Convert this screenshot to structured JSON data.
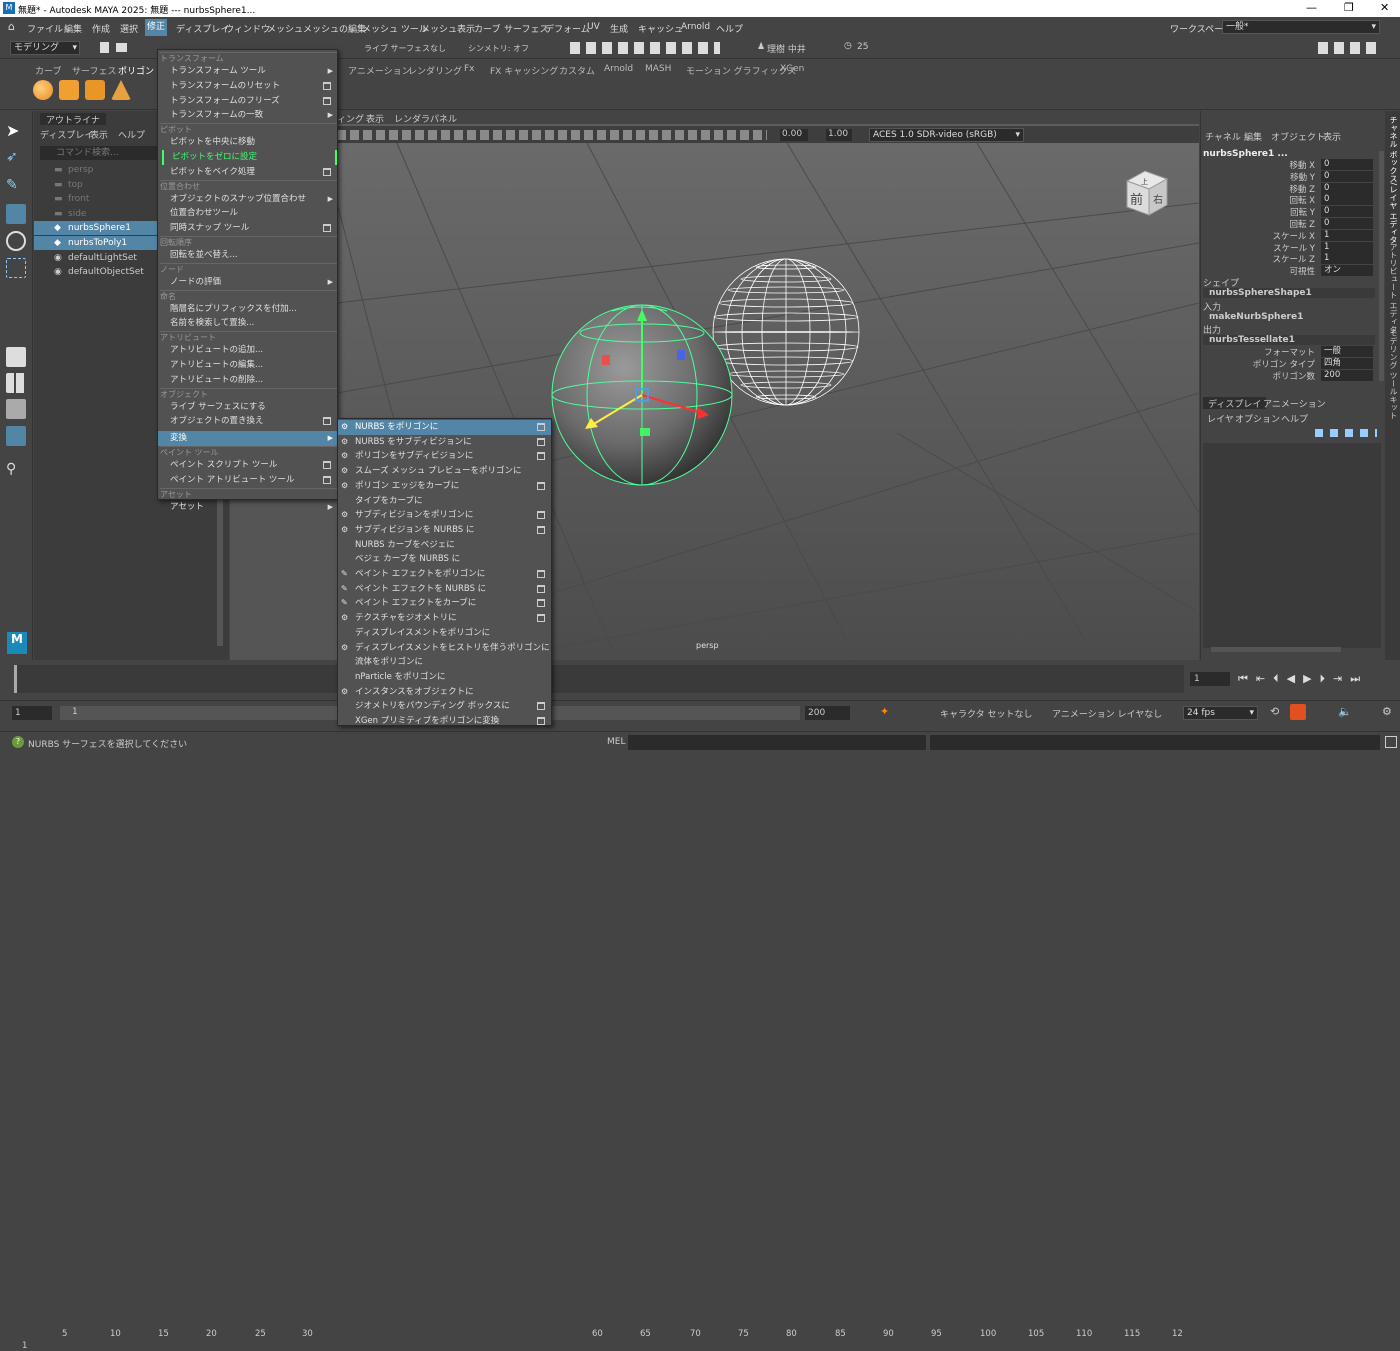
{
  "titlebar": {
    "title": "無題* - Autodesk MAYA 2025: 無題 --- nurbsSphere1...",
    "minimize": "—",
    "maximize": "❐",
    "close": "✕"
  },
  "menubar": {
    "items": [
      "ファイル",
      "編集",
      "作成",
      "選択",
      "修正",
      "ディスプレイ",
      "ウィンドウ",
      "メッシュ",
      "メッシュの編集",
      "メッシュ ツール",
      "メッシュ表示",
      "カーブ",
      "サーフェス",
      "デフォーム",
      "UV",
      "生成",
      "キャッシュ",
      "Arnold",
      "ヘルプ"
    ],
    "workspace_label": "ワークスペース:",
    "workspace_value": "一般*"
  },
  "statusline": {
    "mode": "モデリング",
    "live": "ライブ サーフェスなし",
    "symmetry": "シンメトリ: オフ",
    "user": "理樹 中井",
    "count": "25"
  },
  "shelf": {
    "tabs": [
      "カーブ",
      "サーフェス",
      "ポリゴン",
      "アニメーション",
      "レンダリング",
      "Fx",
      "FX キャッシング",
      "カスタム",
      "Arnold",
      "MASH",
      "モーション グラフィックス",
      "XGen"
    ]
  },
  "outliner": {
    "title": "アウトライナ",
    "menus": [
      "ディスプレイ",
      "表示",
      "ヘルプ"
    ],
    "search_placeholder": "コマンド検索...",
    "items": [
      {
        "name": "persp",
        "dim": true
      },
      {
        "name": "top",
        "dim": true
      },
      {
        "name": "front",
        "dim": true
      },
      {
        "name": "side",
        "dim": true
      },
      {
        "name": "nurbsSphere1",
        "selected": true
      },
      {
        "name": "nurbsToPoly1",
        "selected": true
      },
      {
        "name": "defaultLightSet",
        "dim": false
      },
      {
        "name": "defaultObjectSet",
        "dim": false
      }
    ]
  },
  "viewport": {
    "menus": [
      "ィング",
      "表示",
      "レンダラ",
      "パネル"
    ],
    "exposure": "0.00",
    "gamma": "1.00",
    "colorspace": "ACES 1.0 SDR-video (sRGB)",
    "camera": "persp",
    "cube_front": "前",
    "cube_right": "右",
    "cube_top": "上"
  },
  "modify_menu": {
    "sections": [
      {
        "header": "トランスフォーム",
        "items": [
          {
            "label": "トランスフォーム ツール",
            "arrow": true
          },
          {
            "label": "トランスフォームのリセット",
            "box": true
          },
          {
            "label": "トランスフォームのフリーズ",
            "box": true
          },
          {
            "label": "トランスフォームの一致",
            "arrow": true
          }
        ]
      },
      {
        "header": "ピボット",
        "items": [
          {
            "label": "ピボットを中央に移動"
          },
          {
            "label": "ピボットをゼロに設定",
            "green": true
          },
          {
            "label": "ピボットをベイク処理",
            "box": true
          }
        ]
      },
      {
        "header": "位置合わせ",
        "items": [
          {
            "label": "オブジェクトのスナップ位置合わせ",
            "arrow": true
          },
          {
            "label": "位置合わせツール"
          },
          {
            "label": "同時スナップ ツール",
            "box": true
          }
        ]
      },
      {
        "header": "回転順序",
        "items": [
          {
            "label": "回転を並べ替え..."
          }
        ]
      },
      {
        "header": "ノード",
        "items": [
          {
            "label": "ノードの評価",
            "arrow": true
          }
        ]
      },
      {
        "header": "命名",
        "items": [
          {
            "label": "階層名にプリフィックスを付加..."
          },
          {
            "label": "名前を検索して置換..."
          }
        ]
      },
      {
        "header": "アトリビュート",
        "items": [
          {
            "label": "アトリビュートの追加..."
          },
          {
            "label": "アトリビュートの編集..."
          },
          {
            "label": "アトリビュートの削除..."
          }
        ]
      },
      {
        "header": "オブジェクト",
        "items": [
          {
            "label": "ライブ サーフェスにする"
          },
          {
            "label": "オブジェクトの置き換え",
            "box": true
          }
        ]
      },
      {
        "header": "",
        "items": [
          {
            "label": "変換",
            "arrow": true,
            "highlight": true
          }
        ]
      },
      {
        "header": "ペイント ツール",
        "items": [
          {
            "label": "ペイント スクリプト ツール",
            "box": true
          },
          {
            "label": "ペイント アトリビュート ツール",
            "box": true
          }
        ]
      },
      {
        "header": "アセット",
        "items": [
          {
            "label": "アセット",
            "arrow": true
          }
        ]
      }
    ]
  },
  "convert_menu": {
    "items": [
      {
        "label": "NURBS をポリゴンに",
        "box": true,
        "highlight": true
      },
      {
        "label": "NURBS をサブディビジョンに",
        "box": true
      },
      {
        "label": "ポリゴンをサブディビジョンに",
        "box": true
      },
      {
        "label": "スムーズ メッシュ プレビューをポリゴンに"
      },
      {
        "label": "ポリゴン エッジをカーブに",
        "box": true
      },
      {
        "label": "タイプをカーブに"
      },
      {
        "label": "サブディビジョンをポリゴンに",
        "box": true
      },
      {
        "label": "サブディビジョンを NURBS に",
        "box": true
      },
      {
        "label": "NURBS カーブをベジェに"
      },
      {
        "label": "ベジェ カーブを NURBS に"
      },
      {
        "label": "ペイント エフェクトをポリゴンに",
        "box": true
      },
      {
        "label": "ペイント エフェクトを NURBS に",
        "box": true
      },
      {
        "label": "ペイント エフェクトをカーブに",
        "box": true
      },
      {
        "label": "テクスチャをジオメトリに",
        "box": true
      },
      {
        "label": "ディスプレイスメントをポリゴンに"
      },
      {
        "label": "ディスプレイスメントをヒストリを伴うポリゴンに"
      },
      {
        "label": "流体をポリゴンに"
      },
      {
        "label": "nParticle をポリゴンに"
      },
      {
        "label": "インスタンスをオブジェクトに"
      },
      {
        "label": "ジオメトリをバウンディング ボックスに",
        "box": true
      },
      {
        "label": "XGen プリミティブをポリゴンに変換",
        "box": true
      }
    ]
  },
  "channelbox": {
    "menus": [
      "チャネル",
      "編集",
      "オブジェクト",
      "表示"
    ],
    "object": "nurbsSphere1 ...",
    "attrs": [
      {
        "label": "移動 X",
        "value": "0"
      },
      {
        "label": "移動 Y",
        "value": "0"
      },
      {
        "label": "移動 Z",
        "value": "0"
      },
      {
        "label": "回転 X",
        "value": "0"
      },
      {
        "label": "回転 Y",
        "value": "0"
      },
      {
        "label": "回転 Z",
        "value": "0"
      },
      {
        "label": "スケール X",
        "value": "1"
      },
      {
        "label": "スケール Y",
        "value": "1"
      },
      {
        "label": "スケール Z",
        "value": "1"
      },
      {
        "label": "可視性",
        "value": "オン"
      }
    ],
    "shape_header": "シェイプ",
    "shape": "nurbsSphereShape1",
    "input_header": "入力",
    "input": "makeNurbSphere1",
    "output_header": "出力",
    "output": "nurbsTessellate1",
    "tess_attrs": [
      {
        "label": "フォーマット",
        "value": "一般"
      },
      {
        "label": "ポリゴン タイプ",
        "value": "四角"
      },
      {
        "label": "ポリゴン数",
        "value": "200"
      }
    ],
    "layer_tabs": [
      "ディスプレイ",
      "アニメーション"
    ],
    "layer_menus": [
      "レイヤ",
      "オプション",
      "ヘルプ"
    ]
  },
  "sidetabs": [
    "チャネル ボックス/レイヤ エディタ",
    "アトリビュート エディタ",
    "モデリング ツールキット"
  ],
  "timeline": {
    "ticks": [
      "1",
      "5",
      "10",
      "15",
      "20",
      "25",
      "30",
      "60",
      "65",
      "70",
      "75",
      "80",
      "85",
      "90",
      "95",
      "100",
      "105",
      "110",
      "115",
      "12"
    ],
    "current": "1"
  },
  "range": {
    "start": "1",
    "inner_start": "1",
    "end": "200",
    "character": "キャラクタ セットなし",
    "anim_layer": "アニメーション レイヤなし",
    "fps": "24 fps"
  },
  "help": {
    "text": "NURBS サーフェスを選択してください",
    "mel": "MEL"
  },
  "colors": {
    "highlight": "#5285a6",
    "green": "#3cff6e",
    "wire": "#4cff9a"
  }
}
